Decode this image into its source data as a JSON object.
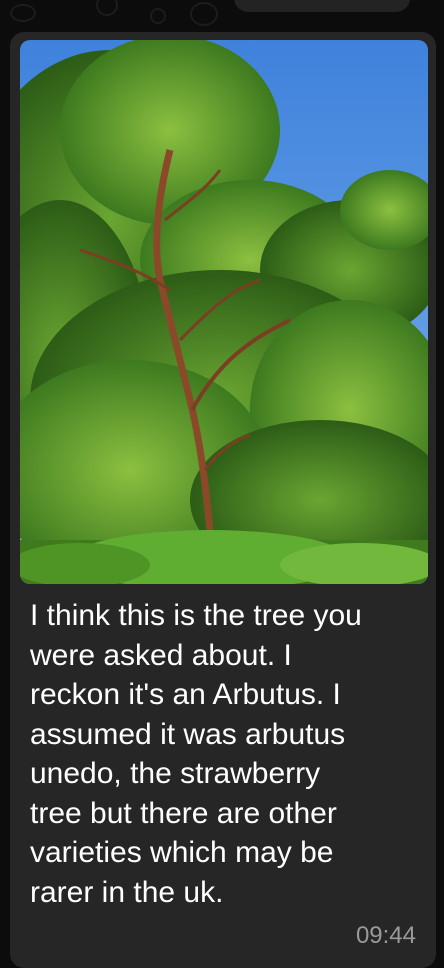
{
  "message": {
    "text": "I think this is the tree you\nwere asked about. I\nreckon it's an Arbutus. I\nassumed it was arbutus\nunedo, the strawberry\ntree but there are other\nvarieties which may be\nrarer in the uk.",
    "time": "09:44"
  },
  "colors": {
    "chat_background": "#0c0c0c",
    "bubble": "#262626",
    "text": "#ffffff",
    "timestamp": "#9a9a9a",
    "sky": "#4f8fe0",
    "foliage": "#4a8a26",
    "ferns": "#5fae32",
    "trunk": "#8a4a2a"
  },
  "icons": {
    "photo": "tree-photo"
  }
}
